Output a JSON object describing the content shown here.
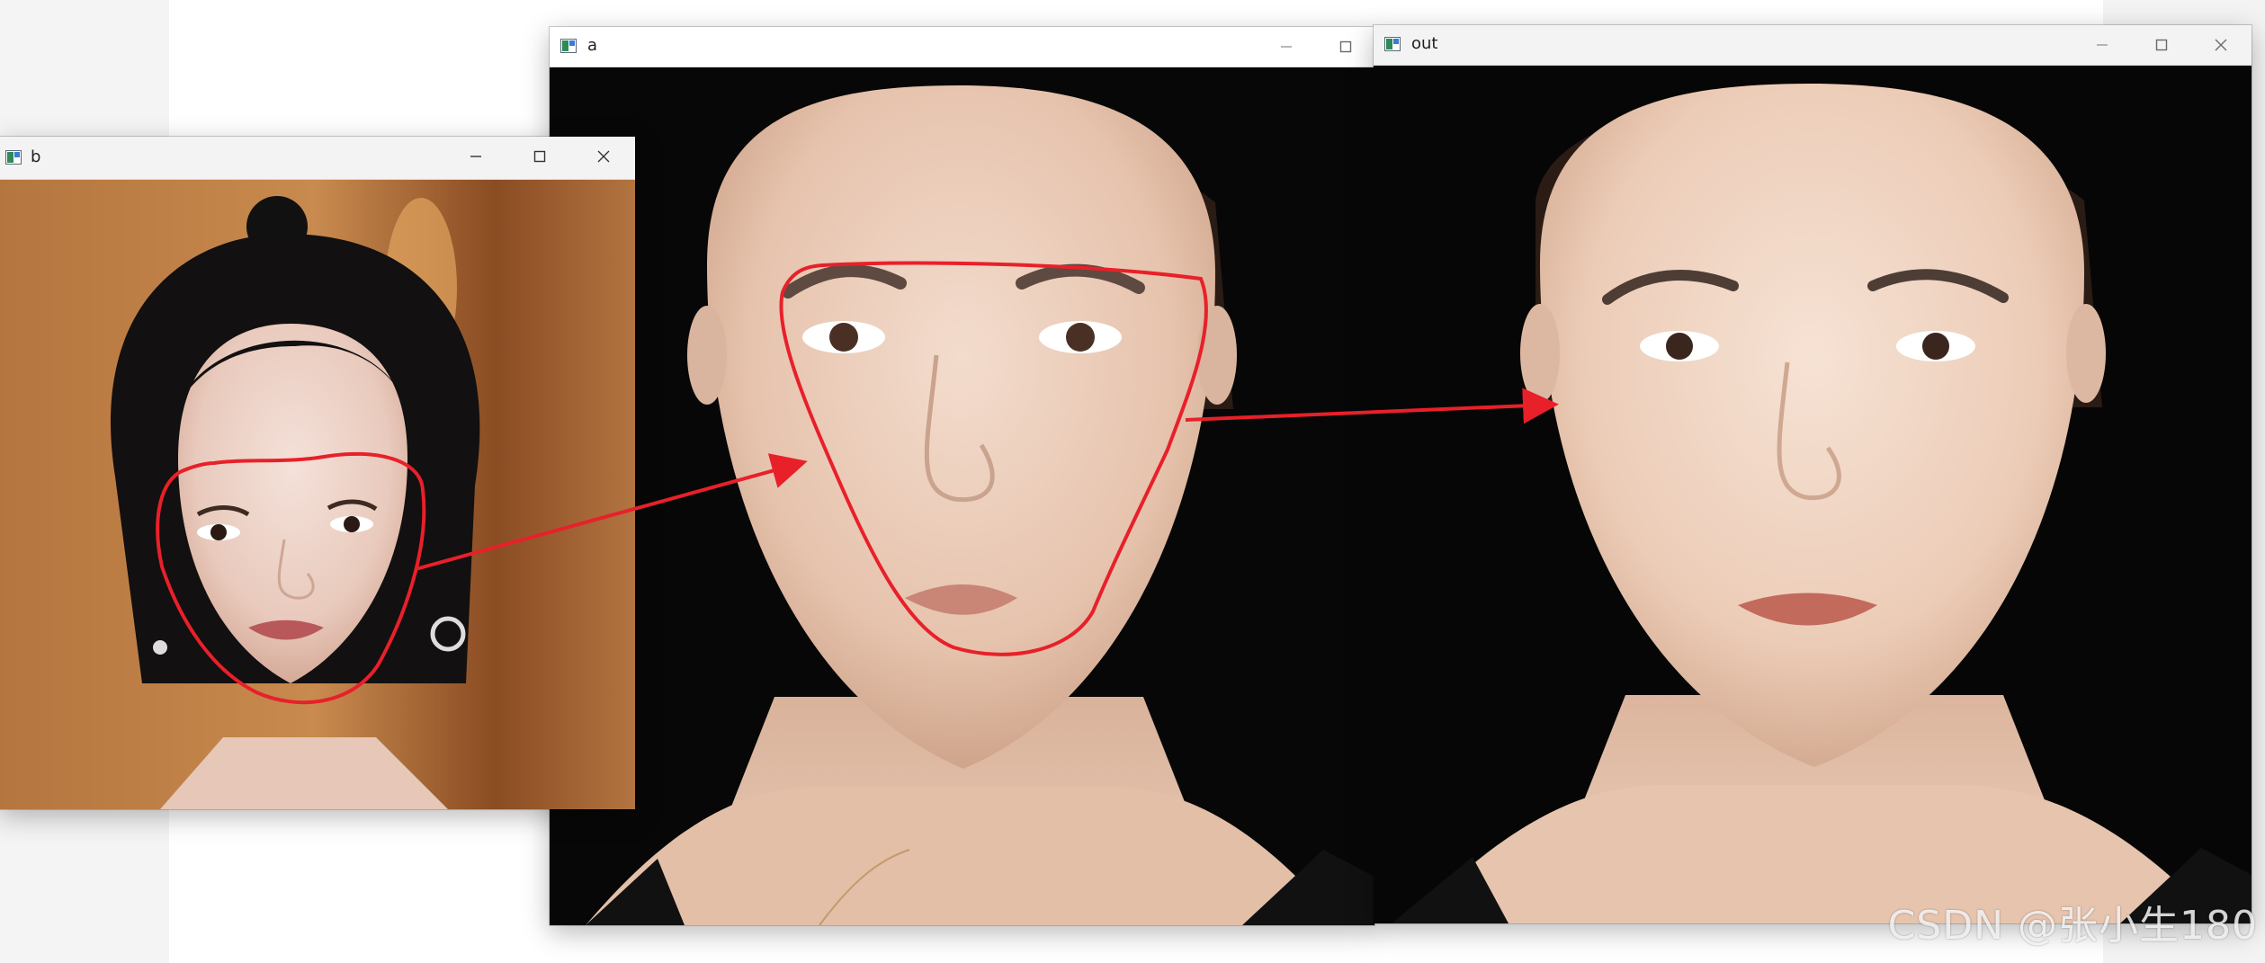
{
  "windows": {
    "b": {
      "title": "b"
    },
    "a": {
      "title": "a"
    },
    "out": {
      "title": "out"
    }
  },
  "watermark": "CSDN @张小生180",
  "icons": {
    "app": "opencv-window-icon",
    "minimize": "minimize-icon",
    "maximize": "maximize-icon",
    "close": "close-icon"
  },
  "colors": {
    "annotation": "#e8202a",
    "titlebar": "#f3f3f3"
  }
}
